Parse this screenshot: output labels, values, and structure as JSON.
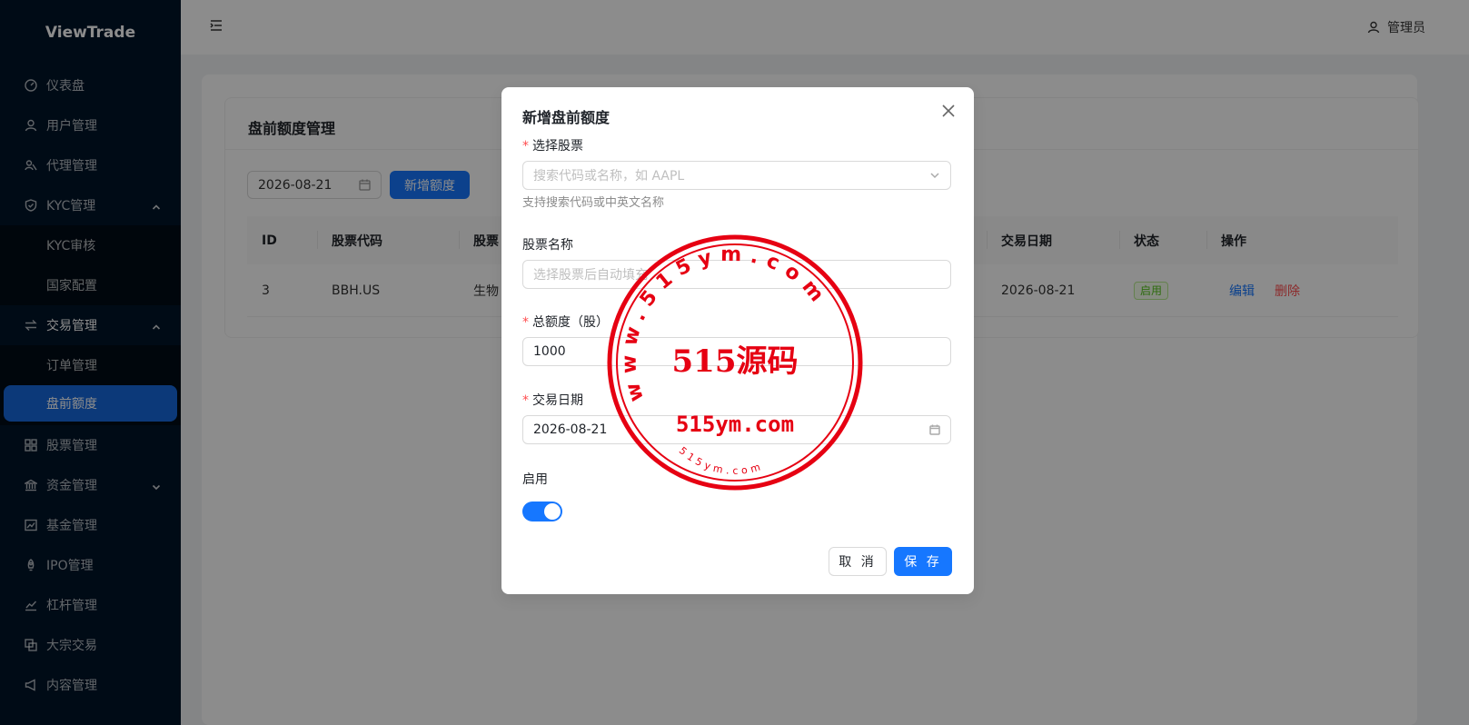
{
  "brand": "ViewTrade",
  "sidebar": {
    "items": [
      {
        "label": "仪表盘"
      },
      {
        "label": "用户管理"
      },
      {
        "label": "代理管理"
      },
      {
        "label": "KYC管理"
      },
      {
        "label": "KYC审核"
      },
      {
        "label": "国家配置"
      },
      {
        "label": "交易管理"
      },
      {
        "label": "订单管理"
      },
      {
        "label": "盘前额度"
      },
      {
        "label": "股票管理"
      },
      {
        "label": "资金管理"
      },
      {
        "label": "基金管理"
      },
      {
        "label": "IPO管理"
      },
      {
        "label": "杠杆管理"
      },
      {
        "label": "大宗交易"
      },
      {
        "label": "内容管理"
      }
    ]
  },
  "header": {
    "user": "管理员"
  },
  "page": {
    "title": "盘前额度管理",
    "date_filter": "2026-08-21",
    "add_button": "新增额度",
    "table": {
      "columns": [
        "ID",
        "股票代码",
        "股票",
        "交易日期",
        "状态",
        "操作"
      ],
      "rows": [
        {
          "id": "3",
          "code": "BBH.US",
          "name": "生物",
          "date": "2026-08-21",
          "status": "启用",
          "edit": "编辑",
          "delete": "删除"
        }
      ]
    }
  },
  "modal": {
    "title": "新增盘前额度",
    "stock_label": "选择股票",
    "stock_placeholder": "搜索代码或名称，如 AAPL",
    "stock_help": "支持搜索代码或中英文名称",
    "name_label": "股票名称",
    "name_placeholder": "选择股票后自动填充",
    "quota_label": "总额度（股）",
    "quota_value": "1000",
    "date_label": "交易日期",
    "date_value": "2026-08-21",
    "enable_label": "启用",
    "enabled": true,
    "cancel": "取 消",
    "save": "保 存"
  },
  "watermark": {
    "ring_text": "www.515ym.com",
    "main_text": "515源码",
    "sub_text": "515ym.com",
    "small_text": "515ym.com",
    "color": "#e60012"
  },
  "colors": {
    "sidebar_bg": "#001529",
    "primary": "#1677ff",
    "danger": "#ff4d4f"
  }
}
